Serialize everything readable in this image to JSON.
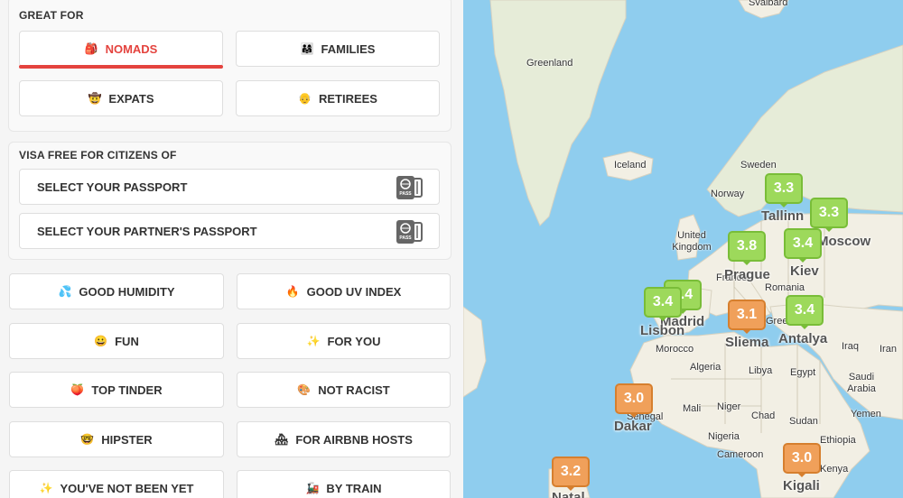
{
  "great_for": {
    "title": "GREAT FOR",
    "items": [
      {
        "label": "NOMADS",
        "emoji": "🎒",
        "active": true
      },
      {
        "label": "FAMILIES",
        "emoji": "👨‍👩‍👧"
      },
      {
        "label": "EXPATS",
        "emoji": "🤠"
      },
      {
        "label": "RETIREES",
        "emoji": "👴"
      }
    ]
  },
  "visa": {
    "title": "VISA FREE FOR CITIZENS OF",
    "passport_label": "SELECT YOUR PASSPORT",
    "partner_label": "SELECT YOUR PARTNER'S PASSPORT",
    "icon_text": "PASS"
  },
  "filters": [
    {
      "label": "GOOD HUMIDITY",
      "emoji": "💦"
    },
    {
      "label": "GOOD UV INDEX",
      "emoji": "🔥"
    },
    {
      "label": "FUN",
      "emoji": "😀"
    },
    {
      "label": "FOR YOU",
      "emoji": "✨"
    },
    {
      "label": "TOP TINDER",
      "emoji": "🍑"
    },
    {
      "label": "NOT RACIST",
      "emoji": "🎨"
    },
    {
      "label": "HIPSTER",
      "emoji": "🤓"
    },
    {
      "label": "FOR AIRBNB HOSTS",
      "emoji": "🏘"
    },
    {
      "label": "YOU'VE NOT BEEN YET",
      "emoji": "✨"
    },
    {
      "label": "BY TRAIN",
      "emoji": "🚂"
    }
  ],
  "map": {
    "colors": {
      "water": "#8fcdee",
      "land": "#f2efe4",
      "green_pin": "#9dd95b",
      "orange_pin": "#f0a05a"
    },
    "places": [
      "Svalbard",
      "Greenland",
      "Iceland",
      "Sweden",
      "Norway",
      "United Kingdom",
      "France",
      "Romania",
      "Morocco",
      "Algeria",
      "Libya",
      "Egypt",
      "Iraq",
      "Iran",
      "Saudi Arabia",
      "Yemen",
      "Senegal",
      "Mali",
      "Niger",
      "Chad",
      "Sudan",
      "Nigeria",
      "Cameroon",
      "Ethiopia",
      "Kenya",
      "Greece"
    ],
    "cities": [
      "Tallinn",
      "Moscow",
      "Prague",
      "Kiev",
      "Madrid",
      "Lisbon",
      "Sliema",
      "Antalya",
      "Dakar",
      "Kigali",
      "Natal"
    ],
    "markers": [
      {
        "score": "3.3",
        "tone": "green"
      },
      {
        "score": "3.3",
        "tone": "green"
      },
      {
        "score": "3.8",
        "tone": "green"
      },
      {
        "score": "3.4",
        "tone": "green"
      },
      {
        "score": "3.4",
        "tone": "green"
      },
      {
        "score": "3.4",
        "tone": "green"
      },
      {
        "score": "3.1",
        "tone": "orange"
      },
      {
        "score": "3.4",
        "tone": "green"
      },
      {
        "score": "3.0",
        "tone": "orange"
      },
      {
        "score": "3.0",
        "tone": "orange"
      },
      {
        "score": "3.2",
        "tone": "orange"
      }
    ]
  }
}
